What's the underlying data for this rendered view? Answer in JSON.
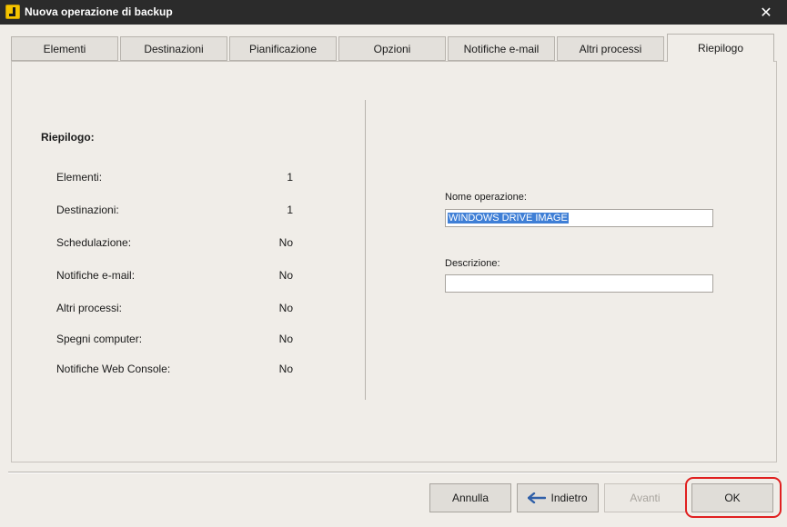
{
  "window": {
    "title": "Nuova operazione di backup",
    "close_glyph": "✕"
  },
  "tabs": [
    {
      "label": "Elementi"
    },
    {
      "label": "Destinazioni"
    },
    {
      "label": "Pianificazione"
    },
    {
      "label": "Opzioni"
    },
    {
      "label": "Notifiche e-mail"
    },
    {
      "label": "Altri processi"
    },
    {
      "label": "Riepilogo",
      "active": true
    }
  ],
  "summary": {
    "heading": "Riepilogo:",
    "rows": [
      {
        "label": "Elementi:",
        "value": "1"
      },
      {
        "label": "Destinazioni:",
        "value": "1"
      },
      {
        "label": "Schedulazione:",
        "value": "No"
      },
      {
        "label": "Notifiche e-mail:",
        "value": "No"
      },
      {
        "label": "Altri processi:",
        "value": "No"
      },
      {
        "label": "Spegni computer:",
        "value": "No"
      },
      {
        "label": "Notifiche Web Console:",
        "value": "No"
      }
    ]
  },
  "form": {
    "name_label": "Nome operazione:",
    "name_value": "WINDOWS DRIVE IMAGE",
    "description_label": "Descrizione:",
    "description_value": ""
  },
  "buttons": {
    "cancel": "Annulla",
    "back": "Indietro",
    "next": "Avanti",
    "ok": "OK"
  },
  "colors": {
    "titlebar": "#2b2b2b",
    "window_bg": "#f0ede8",
    "selection": "#3f7fd6",
    "highlight": "#e02020",
    "back_arrow": "#2f5fa8"
  }
}
